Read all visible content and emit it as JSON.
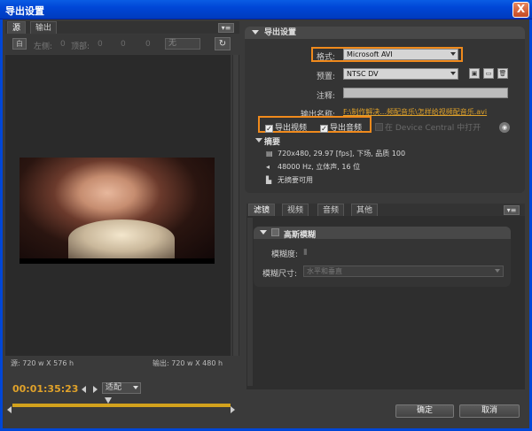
{
  "window": {
    "title": "导出设置",
    "close_label": "X"
  },
  "left_panel": {
    "tabs": [
      {
        "label": "源"
      },
      {
        "label": "输出"
      }
    ],
    "menu_icon": "▾≡",
    "crop": {
      "icon_label": "白",
      "left_label": "左侧:",
      "left_value": "0",
      "top_label": "顶部:",
      "top_value": "0",
      "right_value": "0",
      "bottom_value": "0",
      "ratio_value": "无",
      "rotate_icon": "rotate-icon"
    },
    "source_info": "源: 720 w X 576 h",
    "output_info": "输出: 720 w X 480 h",
    "timecode": "00:01:35:23",
    "fit_value": "适配"
  },
  "export_settings": {
    "header": "导出设置",
    "format_label": "格式:",
    "format_value": "Microsoft AVI",
    "preset_label": "预置:",
    "preset_value": "NTSC DV",
    "comment_label": "注释:",
    "comment_value": "",
    "outname_label": "输出名称:",
    "outname_value": "F:\\制作解决...频配音乐\\怎样给视频配音乐.avi",
    "export_video_label": "导出视频",
    "export_audio_label": "导出音频",
    "device_central_label": "在 Device Central 中打开",
    "summary_title": "摘要",
    "summary_video": "720x480, 29.97 [fps], 下场, 品质 100",
    "summary_audio": "48000 Hz, 立体声, 16 位",
    "summary_none": "无摘要可用"
  },
  "filter_panel": {
    "tabs": [
      {
        "label": "滤镜"
      },
      {
        "label": "视频"
      },
      {
        "label": "音频"
      },
      {
        "label": "其他"
      }
    ],
    "gauss_title": "高斯模糊",
    "blur_amount_label": "模糊度:",
    "blur_dimension_label": "模糊尺寸:",
    "blur_dimension_value": "水平和垂直"
  },
  "buttons": {
    "ok": "确定",
    "cancel": "取消"
  },
  "colors": {
    "accent_orange": "#f08a1c",
    "timecode": "#e0a22a",
    "titlebar": "#0046d6"
  }
}
